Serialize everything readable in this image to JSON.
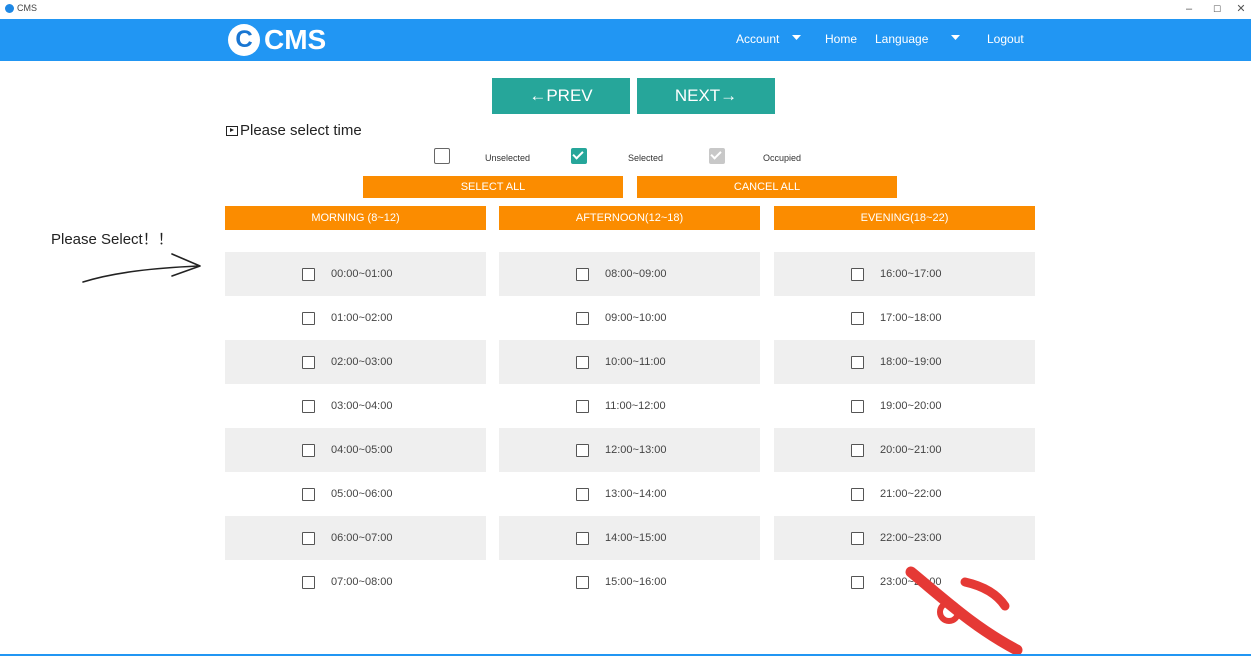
{
  "window": {
    "title": "CMS",
    "controls": [
      "–",
      "☐",
      "✕"
    ]
  },
  "navbar": {
    "logo_letter": "C",
    "logo_text": "CMS",
    "account": "Account",
    "home": "Home",
    "language": "Language",
    "logout": "Logout"
  },
  "pager": {
    "prev": "←PREV",
    "next": "NEXT→"
  },
  "section_title": "Please select time",
  "legend": {
    "unselected": "Unselected",
    "selected": "Selected",
    "occupied": "Occupied"
  },
  "actions": {
    "select_all": "SELECT ALL",
    "cancel_all": "CANCEL ALL"
  },
  "columns": [
    {
      "header": "MORNING (8~12)",
      "slots": [
        "00:00~01:00",
        "01:00~02:00",
        "02:00~03:00",
        "03:00~04:00",
        "04:00~05:00",
        "05:00~06:00",
        "06:00~07:00",
        "07:00~08:00"
      ]
    },
    {
      "header": "AFTERNOON(12~18)",
      "slots": [
        "08:00~09:00",
        "09:00~10:00",
        "10:00~11:00",
        "11:00~12:00",
        "12:00~13:00",
        "13:00~14:00",
        "14:00~15:00",
        "15:00~16:00"
      ]
    },
    {
      "header": "EVENING(18~22)",
      "slots": [
        "16:00~17:00",
        "17:00~18:00",
        "18:00~19:00",
        "19:00~20:00",
        "20:00~21:00",
        "21:00~22:00",
        "22:00~23:00",
        "23:00~24:00"
      ]
    }
  ],
  "annotation": {
    "text": "Please Select！！"
  },
  "colors": {
    "navbar": "#2196f3",
    "teal": "#26a69a",
    "orange": "#fb8c00",
    "watermark": "#e53935"
  }
}
